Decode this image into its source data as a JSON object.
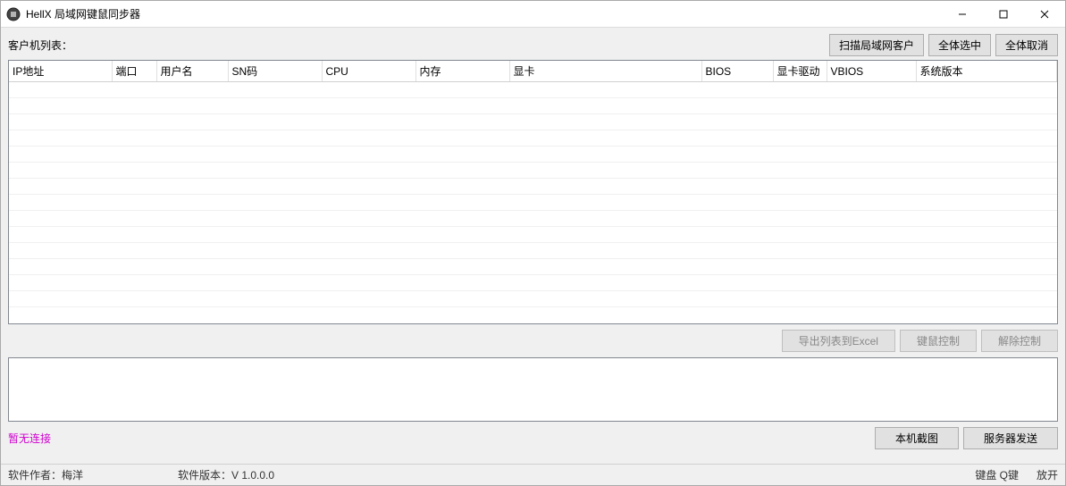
{
  "window": {
    "title": "HellX 局域网键鼠同步器"
  },
  "top": {
    "client_list_label": "客户机列表：",
    "scan_btn": "扫描局域网客户",
    "select_all_btn": "全体选中",
    "deselect_all_btn": "全体取消"
  },
  "columns": {
    "ip": "IP地址",
    "port": "端口",
    "user": "用户名",
    "sn": "SN码",
    "cpu": "CPU",
    "mem": "内存",
    "gpu": "显卡",
    "bios": "BIOS",
    "gpu_driver": "显卡驱动",
    "vbios": "VBIOS",
    "os": "系统版本"
  },
  "rows": [],
  "mid": {
    "export_btn": "导出列表到Excel",
    "km_control_btn": "键鼠控制",
    "release_btn": "解除控制"
  },
  "bottom": {
    "conn_status": "暂无连接",
    "screenshot_btn": "本机截图",
    "server_send_btn": "服务器发送"
  },
  "status": {
    "author": "软件作者：梅洋",
    "version": "软件版本：V 1.0.0.0",
    "kb_label": "键盘 Q键",
    "kb_state": "放开"
  }
}
